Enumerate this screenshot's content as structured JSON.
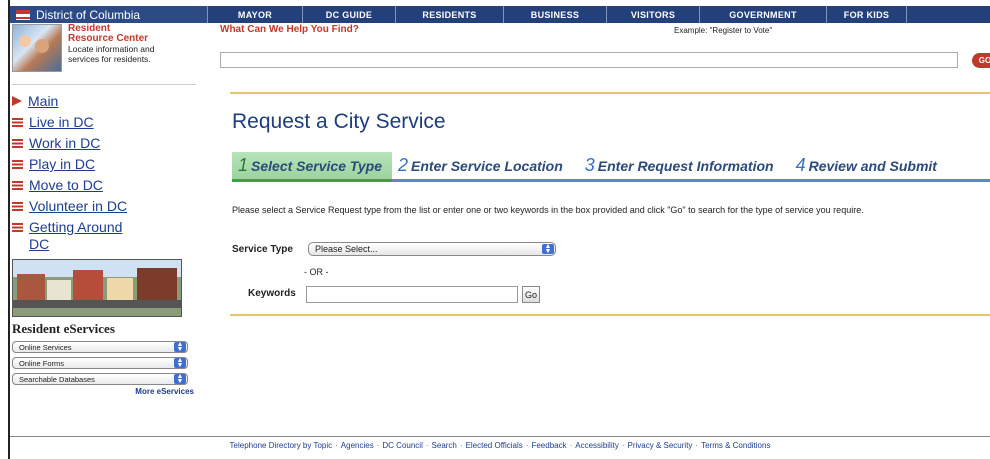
{
  "header": {
    "brand": "District of Columbia",
    "nav": [
      "MAYOR",
      "DC GUIDE",
      "RESIDENTS",
      "BUSINESS",
      "VISITORS",
      "GOVERNMENT",
      "FOR KIDS"
    ]
  },
  "sidebar": {
    "rrc_title_1": "Resident",
    "rrc_title_2": "Resource Center",
    "rrc_desc_1": "Locate information and",
    "rrc_desc_2": "services for residents.",
    "items": [
      {
        "label": "Main",
        "icon": "arrow-icon"
      },
      {
        "label": "Live in DC",
        "icon": "dc-flag-icon"
      },
      {
        "label": "Work in DC",
        "icon": "dc-flag-icon"
      },
      {
        "label": "Play in DC",
        "icon": "dc-flag-icon"
      },
      {
        "label": "Move to DC",
        "icon": "dc-flag-icon"
      },
      {
        "label": "Volunteer in DC",
        "icon": "dc-flag-icon"
      },
      {
        "label": "Getting Around DC",
        "icon": "dc-flag-icon"
      }
    ],
    "eservices_title": "Resident eServices",
    "eservices_selects": [
      "Online Services",
      "Online Forms",
      "Searchable Databases"
    ],
    "more_link": "More eServices"
  },
  "main": {
    "help_label": "What Can We Help You Find?",
    "example_text": "Example: \"Register to Vote\"",
    "search_value": "",
    "search_go": "GO",
    "page_title": "Request a City Service",
    "steps": [
      {
        "num": "1",
        "label": "Select Service Type",
        "active": true
      },
      {
        "num": "2",
        "label": "Enter Service Location",
        "active": false
      },
      {
        "num": "3",
        "label": "Enter Request Information",
        "active": false
      },
      {
        "num": "4",
        "label": "Review and Submit",
        "active": false
      }
    ],
    "instructions": "Please select a Service Request type from the list or enter one or two keywords in the box provided and click \"Go\" to search for the type of service you require.",
    "service_type_label": "Service Type",
    "service_type_value": "Please Select...",
    "or_text": "- OR -",
    "keywords_label": "Keywords",
    "keywords_value": "",
    "go_button": "Go"
  },
  "footer": {
    "links": [
      "Telephone Directory by Topic",
      "Agencies",
      "DC Council",
      "Search",
      "Elected Officials",
      "Feedback",
      "Accessibility",
      "Privacy & Security",
      "Terms & Conditions"
    ]
  },
  "colors": {
    "nav_bg": "#24407a",
    "accent_red": "#c0392b",
    "link_blue": "#1e3d8f",
    "step_active": "#9cd49f",
    "gold_rule": "#e3c36b"
  }
}
